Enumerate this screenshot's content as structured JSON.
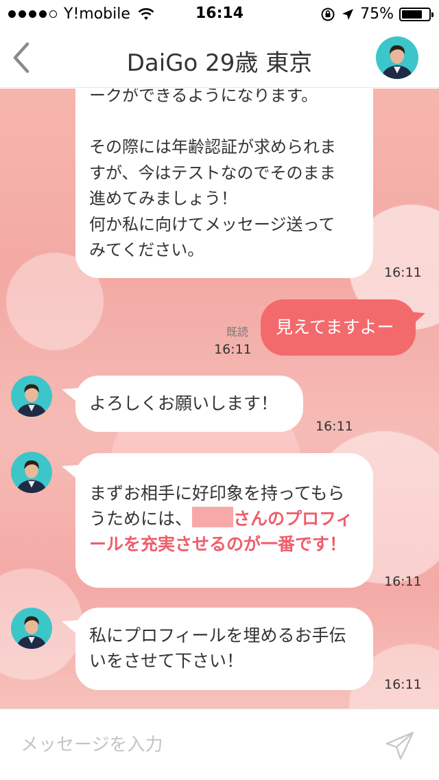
{
  "status_bar": {
    "carrier": "Y!mobile",
    "time": "16:14",
    "battery": "75%",
    "battery_level": 0.75,
    "signal_dots_filled": 4,
    "signal_dots_total": 5
  },
  "nav": {
    "title": "DaiGo 29歳 東京",
    "back_icon": "chevron-left-icon",
    "avatar_icon": "profile-avatar"
  },
  "messages": {
    "m1": {
      "lines": "ークができるようになります。\n\nその際には年齢認証が求められま\nすが、今はテストなのでそのまま\n進めてみましょう！\n何か私に向けてメッセージ送って\nみてください。",
      "time": "16:11"
    },
    "m2": {
      "text": "見えてますよー",
      "read": "既読",
      "time": "16:11"
    },
    "m3": {
      "text": "よろしくお願いします！",
      "time": "16:11"
    },
    "m4": {
      "line1": "まずお相手に好印象を持ってもら",
      "line2_prefix": "うためには、",
      "line2_highlight": "さんのプロフィ",
      "line3_highlight": "ールを充実させるのが一番です！",
      "time": "16:11"
    },
    "m5": {
      "text": "私にプロフィールを埋めるお手伝\nいをさせて下さい！",
      "time": "16:11"
    }
  },
  "input": {
    "placeholder": "メッセージを入力",
    "value": "",
    "send_icon": "paper-plane-icon"
  },
  "colors": {
    "accent": "#f36a6d",
    "highlight_text": "#ef5d6a",
    "background_pink": "#f4aaa6"
  }
}
